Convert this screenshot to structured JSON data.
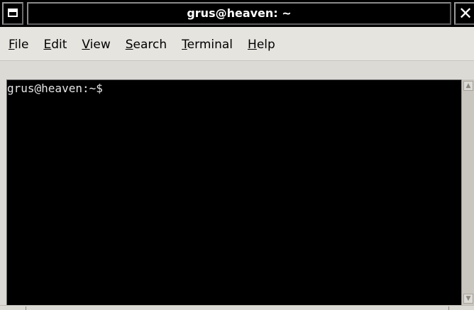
{
  "window": {
    "title": "grus@heaven: ~",
    "menu_icon": "window-menu-icon",
    "close_icon": "close-icon",
    "close_glyph": "✕"
  },
  "menubar": {
    "items": [
      {
        "accel": "F",
        "rest": "ile"
      },
      {
        "accel": "E",
        "rest": "dit"
      },
      {
        "accel": "V",
        "rest": "iew"
      },
      {
        "accel": "S",
        "rest": "earch"
      },
      {
        "accel": "T",
        "rest": "erminal"
      },
      {
        "accel": "H",
        "rest": "elp"
      }
    ]
  },
  "terminal": {
    "prompt": "grus@heaven:~$ ",
    "background": "#000000",
    "foreground": "#e6e6e6"
  },
  "scrollbar": {
    "up_icon": "scroll-up-arrow-icon",
    "down_icon": "scroll-down-arrow-icon",
    "up_glyph": "▲",
    "down_glyph": "▼"
  }
}
